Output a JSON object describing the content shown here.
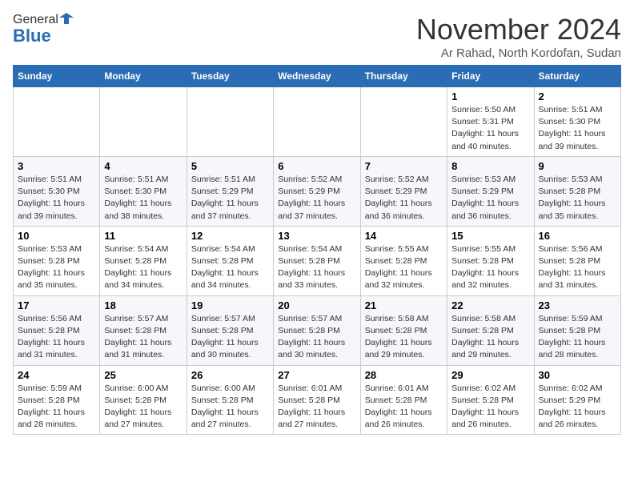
{
  "header": {
    "logo_general": "General",
    "logo_blue": "Blue",
    "month_title": "November 2024",
    "location": "Ar Rahad, North Kordofan, Sudan"
  },
  "days_of_week": [
    "Sunday",
    "Monday",
    "Tuesday",
    "Wednesday",
    "Thursday",
    "Friday",
    "Saturday"
  ],
  "weeks": [
    [
      {
        "day": "",
        "info": ""
      },
      {
        "day": "",
        "info": ""
      },
      {
        "day": "",
        "info": ""
      },
      {
        "day": "",
        "info": ""
      },
      {
        "day": "",
        "info": ""
      },
      {
        "day": "1",
        "info": "Sunrise: 5:50 AM\nSunset: 5:31 PM\nDaylight: 11 hours and 40 minutes."
      },
      {
        "day": "2",
        "info": "Sunrise: 5:51 AM\nSunset: 5:30 PM\nDaylight: 11 hours and 39 minutes."
      }
    ],
    [
      {
        "day": "3",
        "info": "Sunrise: 5:51 AM\nSunset: 5:30 PM\nDaylight: 11 hours and 39 minutes."
      },
      {
        "day": "4",
        "info": "Sunrise: 5:51 AM\nSunset: 5:30 PM\nDaylight: 11 hours and 38 minutes."
      },
      {
        "day": "5",
        "info": "Sunrise: 5:51 AM\nSunset: 5:29 PM\nDaylight: 11 hours and 37 minutes."
      },
      {
        "day": "6",
        "info": "Sunrise: 5:52 AM\nSunset: 5:29 PM\nDaylight: 11 hours and 37 minutes."
      },
      {
        "day": "7",
        "info": "Sunrise: 5:52 AM\nSunset: 5:29 PM\nDaylight: 11 hours and 36 minutes."
      },
      {
        "day": "8",
        "info": "Sunrise: 5:53 AM\nSunset: 5:29 PM\nDaylight: 11 hours and 36 minutes."
      },
      {
        "day": "9",
        "info": "Sunrise: 5:53 AM\nSunset: 5:28 PM\nDaylight: 11 hours and 35 minutes."
      }
    ],
    [
      {
        "day": "10",
        "info": "Sunrise: 5:53 AM\nSunset: 5:28 PM\nDaylight: 11 hours and 35 minutes."
      },
      {
        "day": "11",
        "info": "Sunrise: 5:54 AM\nSunset: 5:28 PM\nDaylight: 11 hours and 34 minutes."
      },
      {
        "day": "12",
        "info": "Sunrise: 5:54 AM\nSunset: 5:28 PM\nDaylight: 11 hours and 34 minutes."
      },
      {
        "day": "13",
        "info": "Sunrise: 5:54 AM\nSunset: 5:28 PM\nDaylight: 11 hours and 33 minutes."
      },
      {
        "day": "14",
        "info": "Sunrise: 5:55 AM\nSunset: 5:28 PM\nDaylight: 11 hours and 32 minutes."
      },
      {
        "day": "15",
        "info": "Sunrise: 5:55 AM\nSunset: 5:28 PM\nDaylight: 11 hours and 32 minutes."
      },
      {
        "day": "16",
        "info": "Sunrise: 5:56 AM\nSunset: 5:28 PM\nDaylight: 11 hours and 31 minutes."
      }
    ],
    [
      {
        "day": "17",
        "info": "Sunrise: 5:56 AM\nSunset: 5:28 PM\nDaylight: 11 hours and 31 minutes."
      },
      {
        "day": "18",
        "info": "Sunrise: 5:57 AM\nSunset: 5:28 PM\nDaylight: 11 hours and 31 minutes."
      },
      {
        "day": "19",
        "info": "Sunrise: 5:57 AM\nSunset: 5:28 PM\nDaylight: 11 hours and 30 minutes."
      },
      {
        "day": "20",
        "info": "Sunrise: 5:57 AM\nSunset: 5:28 PM\nDaylight: 11 hours and 30 minutes."
      },
      {
        "day": "21",
        "info": "Sunrise: 5:58 AM\nSunset: 5:28 PM\nDaylight: 11 hours and 29 minutes."
      },
      {
        "day": "22",
        "info": "Sunrise: 5:58 AM\nSunset: 5:28 PM\nDaylight: 11 hours and 29 minutes."
      },
      {
        "day": "23",
        "info": "Sunrise: 5:59 AM\nSunset: 5:28 PM\nDaylight: 11 hours and 28 minutes."
      }
    ],
    [
      {
        "day": "24",
        "info": "Sunrise: 5:59 AM\nSunset: 5:28 PM\nDaylight: 11 hours and 28 minutes."
      },
      {
        "day": "25",
        "info": "Sunrise: 6:00 AM\nSunset: 5:28 PM\nDaylight: 11 hours and 27 minutes."
      },
      {
        "day": "26",
        "info": "Sunrise: 6:00 AM\nSunset: 5:28 PM\nDaylight: 11 hours and 27 minutes."
      },
      {
        "day": "27",
        "info": "Sunrise: 6:01 AM\nSunset: 5:28 PM\nDaylight: 11 hours and 27 minutes."
      },
      {
        "day": "28",
        "info": "Sunrise: 6:01 AM\nSunset: 5:28 PM\nDaylight: 11 hours and 26 minutes."
      },
      {
        "day": "29",
        "info": "Sunrise: 6:02 AM\nSunset: 5:28 PM\nDaylight: 11 hours and 26 minutes."
      },
      {
        "day": "30",
        "info": "Sunrise: 6:02 AM\nSunset: 5:29 PM\nDaylight: 11 hours and 26 minutes."
      }
    ]
  ]
}
